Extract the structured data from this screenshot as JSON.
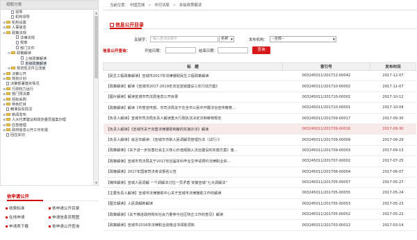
{
  "sidebar": {
    "header": "组配分类",
    "tree": [
      {
        "label": "领导",
        "toggle": "",
        "type": "file",
        "indent": 1
      },
      {
        "label": "机构领导",
        "toggle": "",
        "type": "file",
        "indent": 1
      },
      {
        "label": "机构设置",
        "toggle": "⊞",
        "type": "folder",
        "indent": 0
      },
      {
        "label": "人事信息",
        "toggle": "⊞",
        "type": "folder",
        "indent": 0
      },
      {
        "label": "政策法规",
        "toggle": "⊟",
        "type": "folder",
        "indent": 0
      },
      {
        "label": "法律法规",
        "toggle": "",
        "type": "file",
        "indent": 2
      },
      {
        "label": "规章",
        "toggle": "",
        "type": "file",
        "indent": 2
      },
      {
        "label": "部门文件",
        "toggle": "",
        "type": "file",
        "indent": 2
      },
      {
        "label": "政策解读",
        "toggle": "⊟",
        "type": "folder",
        "indent": 1
      },
      {
        "label": "上级政策解读",
        "toggle": "",
        "type": "file",
        "indent": 3
      },
      {
        "label": "本级政策解读",
        "toggle": "",
        "type": "file",
        "indent": 3,
        "selected": true
      },
      {
        "label": "规范性文件立改废",
        "toggle": "⊞",
        "type": "folder",
        "indent": 1
      },
      {
        "label": "决策公开",
        "toggle": "⊞",
        "type": "folder",
        "indent": 0
      },
      {
        "label": "规划计划",
        "toggle": "⊞",
        "type": "folder",
        "indent": 0
      },
      {
        "label": "决策部署落实情况",
        "toggle": "",
        "type": "file",
        "indent": 0
      },
      {
        "label": "行政权力运行",
        "toggle": "⊞",
        "type": "folder",
        "indent": 0
      },
      {
        "label": "部门预决算",
        "toggle": "⊞",
        "type": "folder",
        "indent": 0
      },
      {
        "label": "招标采购",
        "toggle": "⊞",
        "type": "folder",
        "indent": 0
      },
      {
        "label": "特色栏目",
        "toggle": "⊞",
        "type": "folder",
        "indent": 0
      },
      {
        "label": "精准扶贫情况",
        "toggle": "",
        "type": "file",
        "indent": 0
      },
      {
        "label": "新闻发布",
        "toggle": "⊞",
        "type": "folder",
        "indent": 0
      },
      {
        "label": "人大代表建议和政协委员提案办理",
        "toggle": "⊞",
        "type": "folder",
        "indent": 0
      },
      {
        "label": "应急管理",
        "toggle": "⊞",
        "type": "folder",
        "indent": 0
      },
      {
        "label": "政府信息公开工作年报",
        "toggle": "⊞",
        "type": "folder",
        "indent": 0
      },
      {
        "label": "回应关切",
        "toggle": "",
        "type": "file",
        "indent": 0
      }
    ],
    "apply": {
      "title": "依申请公开",
      "items": [
        "收费标准",
        "依申请公开目录",
        "在线申请",
        "申请信息流程图",
        "申请表下载",
        "依申请公开查询"
      ]
    }
  },
  "breadcrumb": {
    "prefix": "当前位置：",
    "items": [
      "中国宣城",
      "市司法局",
      "本级政策解读"
    ]
  },
  "section_title": "信息公开目录",
  "search": {
    "prefix_label": "信息公开查询：",
    "keyword_label": "关键字：",
    "keyword_placeholder": "输入查询关键字",
    "field_select": "名称",
    "agency_label": "发布机构：",
    "agency_select": "--全部--",
    "start_label": "开始日期：",
    "end_label": "结束日期：",
    "button": "查询"
  },
  "table": {
    "headers": [
      "标　题",
      "索引号",
      "发布时间"
    ],
    "rows": [
      {
        "title": "【民生工程政策解读】宣城市2017年法律援助民生工程政策解读",
        "index": "003245011/201712-00042",
        "date": "2017-12-07"
      },
      {
        "title": "【政策解读】解读《宣城市2017-2019年法治宣城建设三年行动方案》",
        "index": "003245011/201710-00002",
        "date": "2017-11-07"
      },
      {
        "title": "【图片解读】解读宣城市司法局信息公开目录",
        "index": "003245011/201710-00002",
        "date": "2017-10-12"
      },
      {
        "title": "【政策解读】解读《市普宣传部、市司法局关于在全市公民中开展法治宣传教育...",
        "index": "003245011/201710-00001",
        "date": "2017-10-09"
      },
      {
        "title": "【负责人解读】宣城市司法局负责人解读重大行政执法决定法制审核规定",
        "index": "003245011/201709-00017",
        "date": "2017-09-30"
      },
      {
        "title": "【负责人解读】《宣城市关于完善法律援助制度的实施办法》解读",
        "index": "003245011/201709-00016",
        "date": "2017-09-30",
        "highlight": true
      },
      {
        "title": "【负责人解读】就近年解读：《宣城市市职人民调解员管理办法（试行）》",
        "index": "003245011/201709-00009",
        "date": "2017-09-29"
      },
      {
        "title": "【政策解读】《关于进一步完善社会主义核心价值观融入法治建设的实施方案》落...",
        "index": "003245011/201709-00003",
        "date": "2017-09-13"
      },
      {
        "title": "【政策解读】宣城市司法局关于2017年应届本科毕业生申请预约法律职业资...",
        "index": "003245011/201707-00002",
        "date": "2017-07-25"
      },
      {
        "title": "【政策解读】2017年国家司法考试报名公告",
        "index": "003245011/201706-00004",
        "date": "2017-06-07"
      },
      {
        "title": "【媒体解读】宣城人民调解 一个调解法讨拉一员矛盾 安徽宣城“七大调解法”",
        "index": "003245011/201705-00057",
        "date": "2017-05-27"
      },
      {
        "title": "【主要负责人解读】宣城市法律援助中心关于宣城市法律援助工作的解读",
        "index": "003245011/201705-00055",
        "date": "2017-05-24"
      },
      {
        "title": "【图文解读】人民调解新解读",
        "index": "003245011/201705-00053",
        "date": "2017-05-23"
      },
      {
        "title": "【政策解读】《关于推进政府购买社会力量参与社区矫正工作的意见》解读",
        "index": "003245011/201705-00052",
        "date": "2017-05-22"
      },
      {
        "title": "【政策解读】宣城市2016年法律职业资格证书领取须知",
        "index": "003245011/201703-00012",
        "date": "2017-03-14"
      }
    ]
  }
}
